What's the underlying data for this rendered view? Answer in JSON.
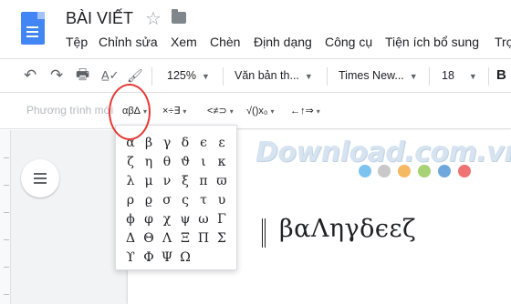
{
  "header": {
    "title": "BÀI VIẾT",
    "star_glyph": "☆",
    "menu": [
      "Tệp",
      "Chỉnh sửa",
      "Xem",
      "Chèn",
      "Định dạng",
      "Công cụ",
      "Tiện ích bổ sung",
      "Trợ"
    ]
  },
  "toolbar": {
    "undo": "↶",
    "redo": "↷",
    "print": "🖶",
    "spellcheck": "A̲✓",
    "paint_format": "🖌",
    "zoom": "125%",
    "style": "Văn bản th...",
    "font": "Times New...",
    "size": "18"
  },
  "equation_bar": {
    "placeholder": "Phương trình mới",
    "greek_button": "αβΔ",
    "operators_button": "×÷∃",
    "relations_button": "<≠⊃",
    "math_button": "√()x₀",
    "arrows_button": "←↑⇒",
    "caret": "▾"
  },
  "greek_popup": {
    "rows": [
      [
        "α",
        "β",
        "γ",
        "δ",
        "ϵ",
        "ε"
      ],
      [
        "ζ",
        "η",
        "θ",
        "ϑ",
        "ι",
        "κ"
      ],
      [
        "λ",
        "μ",
        "ν",
        "ξ",
        "π",
        "ϖ"
      ],
      [
        "ρ",
        "ϱ",
        "σ",
        "ς",
        "τ",
        "υ"
      ],
      [
        "ϕ",
        "φ",
        "χ",
        "ψ",
        "ω",
        "Γ"
      ],
      [
        "Δ",
        "Θ",
        "Λ",
        "Ξ",
        "Π",
        "Σ"
      ],
      [
        "ϒ",
        "Φ",
        "Ψ",
        "Ω"
      ]
    ]
  },
  "document": {
    "equation_text": "βαΛηγδϵεζ"
  },
  "watermark": {
    "text": "Download.com.vn",
    "dot_colors": [
      "#7dc3ef",
      "#c8c8c8",
      "#f5b962",
      "#a7d276",
      "#6fa8dc",
      "#ef7373"
    ]
  },
  "colors": {
    "accent": "#4285f4",
    "highlight_circle": "#e53935"
  }
}
